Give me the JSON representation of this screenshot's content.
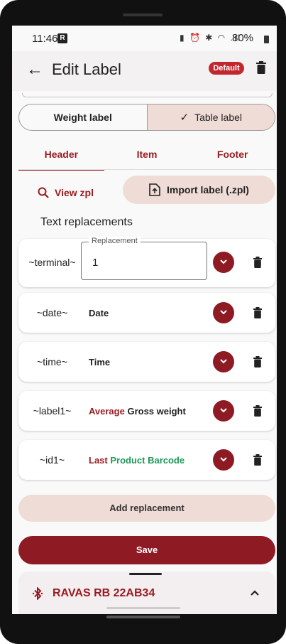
{
  "status_bar": {
    "time": "11:46",
    "notification_letter": "R",
    "icons": [
      "battery-saver",
      "alarm",
      "bluetooth",
      "wifi",
      "signal"
    ],
    "battery": "80%"
  },
  "app_bar": {
    "title": "Edit Label",
    "badge": "Default",
    "back_icon": "arrow-left",
    "delete_icon": "trash"
  },
  "toggle": {
    "options": [
      "Weight label",
      "Table label"
    ],
    "selected": "Table label"
  },
  "tabs": {
    "items": [
      "Header",
      "Item",
      "Footer"
    ],
    "active": "Header"
  },
  "actions": {
    "view_zpl": "View zpl",
    "import_label": "Import label (.zpl)"
  },
  "section_title": "Text replacements",
  "replacements": [
    {
      "key": "~terminal~",
      "field_label": "Replacement",
      "field_value": "1"
    },
    {
      "key": "~date~",
      "value": "Date"
    },
    {
      "key": "~time~",
      "value": "Time"
    },
    {
      "key": "~label1~",
      "value_prefix": "Average",
      "value": "Gross weight"
    },
    {
      "key": "~id1~",
      "value_prefix": "Last",
      "value": "Product Barcode"
    }
  ],
  "buttons": {
    "add_replacement": "Add replacement",
    "save": "Save"
  },
  "bottom_sheet": {
    "device_name": "RAVAS RB 22AB34",
    "icon": "bluetooth"
  },
  "colors": {
    "accent": "#9a1b1f",
    "primary_button": "#8e1a24",
    "tonal_button": "#efdcd6",
    "badge": "#c3272e",
    "green_text": "#1a9a55"
  }
}
